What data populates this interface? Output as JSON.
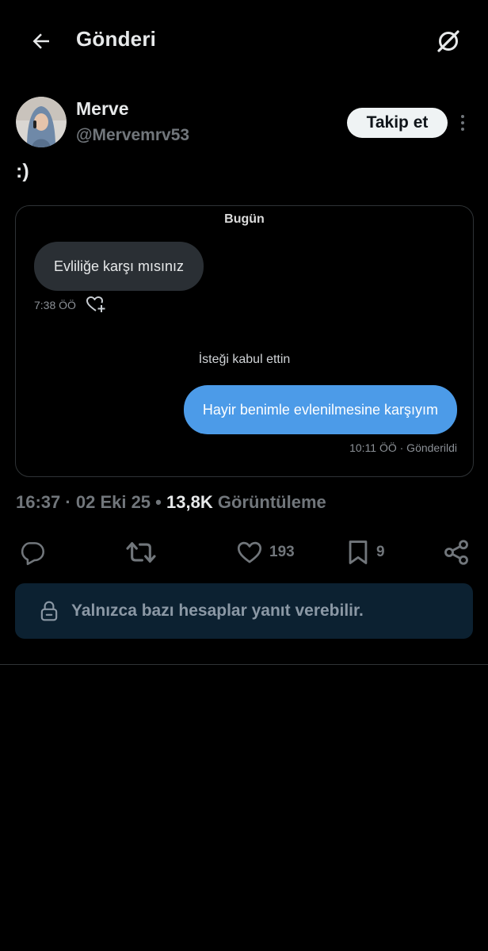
{
  "header": {
    "title": "Gönderi",
    "back_icon": "arrow-left-icon",
    "grok_icon": "grok-icon"
  },
  "author": {
    "name": "Merve",
    "handle": "@Mervemrv53",
    "follow_label": "Takip et"
  },
  "post": {
    "text": ":)"
  },
  "chat": {
    "date_label": "Bugün",
    "incoming_message": "Evliliğe karşı mısınız",
    "incoming_time": "7:38 ÖÖ",
    "system_message": "İsteği kabul ettin",
    "outgoing_message": "Hayir benimle evlenilmesine karşıyım",
    "outgoing_meta": "10:11 ÖÖ · Gönderildi"
  },
  "meta": {
    "time": "16:37",
    "date": "02 Eki 25",
    "views_count": "13,8K",
    "views_label": "Görüntüleme"
  },
  "actions": {
    "reply_count": "",
    "retweet_count": "",
    "like_count": "193",
    "bookmark_count": "9"
  },
  "reply_restriction": {
    "text": "Yalnızca bazı hesaplar yanıt verebilir."
  },
  "colors": {
    "background": "#000000",
    "accent_blue": "#4c9be8",
    "muted": "#71767b",
    "restriction_bg": "#0c2131"
  }
}
